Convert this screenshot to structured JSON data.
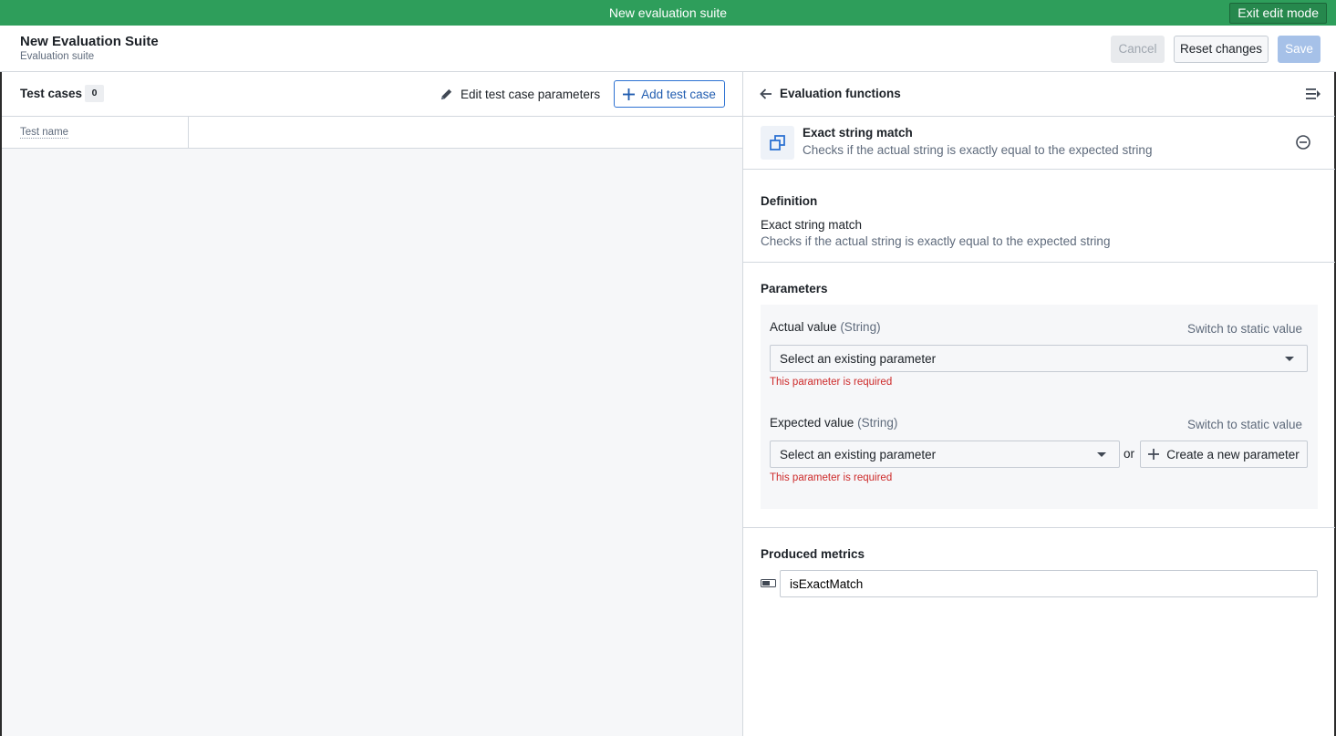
{
  "banner": {
    "title": "New evaluation suite",
    "exit_label": "Exit edit mode"
  },
  "header": {
    "title": "New Evaluation Suite",
    "subtitle": "Evaluation suite",
    "cancel_label": "Cancel",
    "reset_label": "Reset changes",
    "save_label": "Save"
  },
  "test_cases": {
    "title": "Test cases",
    "count": "0",
    "edit_params_label": "Edit test case parameters",
    "add_label": "Add test case",
    "columns": [
      "Test name"
    ]
  },
  "eval_panel": {
    "title": "Evaluation functions",
    "function": {
      "name": "Exact string match",
      "description": "Checks if the actual string is exactly equal to the expected string"
    },
    "definition": {
      "title": "Definition",
      "name": "Exact string match",
      "description": "Checks if the actual string is exactly equal to the expected string"
    },
    "parameters": {
      "title": "Parameters",
      "items": [
        {
          "label": "Actual value",
          "type": "(String)",
          "switch_label": "Switch to static value",
          "select_value": "Select an existing parameter",
          "error": "This parameter is required"
        },
        {
          "label": "Expected value",
          "type": "(String)",
          "switch_label": "Switch to static value",
          "select_value": "Select an existing parameter",
          "error": "This parameter is required",
          "or_label": "or",
          "create_label": "Create a new parameter"
        }
      ]
    },
    "metrics": {
      "title": "Produced metrics",
      "value": "isExactMatch"
    }
  },
  "colors": {
    "banner": "#2e9e5b",
    "primary": "#2d72d2",
    "error": "#cd2a2a"
  }
}
